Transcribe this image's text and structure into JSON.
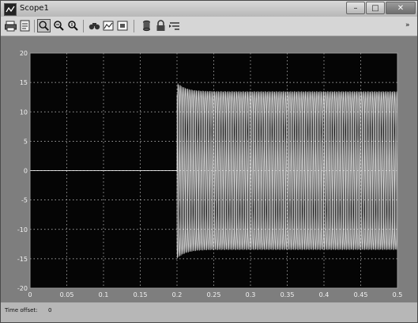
{
  "window": {
    "title": "Scope1",
    "controls": {
      "minimize": "–",
      "maximize": "□",
      "close": "✕"
    }
  },
  "toolbar": {
    "icons": [
      "print-icon",
      "parameters-icon",
      "zoom-icon",
      "zoom-x-icon",
      "zoom-y-icon",
      "autoscale-icon",
      "save-axes-icon",
      "restore-axes-icon",
      "floating-scope-icon",
      "lock-icon",
      "signal-selection-icon"
    ],
    "overflow": "»"
  },
  "status": {
    "label": "Time offset:",
    "value": "0"
  },
  "colors": {
    "plot_bg": "#050505",
    "trace": "#ffffff",
    "grid": "#cfcfcf",
    "frame": "#7e7e7e"
  },
  "chart_data": {
    "type": "line",
    "grid": true,
    "x_ticks": [
      "0",
      "0.05",
      "0.1",
      "0.15",
      "0.2",
      "0.25",
      "0.3",
      "0.35",
      "0.4",
      "0.45",
      "0.5"
    ],
    "y_ticks": [
      "20",
      "15",
      "10",
      "5",
      "0",
      "-5",
      "-10",
      "-15",
      "-20"
    ],
    "xlim": [
      0,
      0.5
    ],
    "ylim": [
      -20,
      20
    ],
    "series": [
      {
        "x_start": 0.2,
        "x_end": 0.5,
        "pre_value": 0,
        "frequency_hz": 200,
        "amplitude_peak": 15,
        "amplitude_steady": 13.5,
        "phase_count": 3
      }
    ]
  }
}
